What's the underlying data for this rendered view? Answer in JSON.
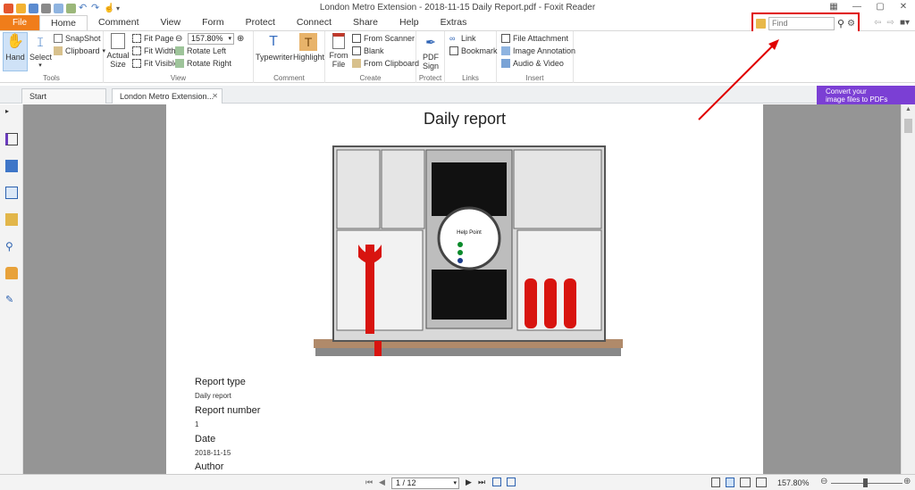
{
  "window": {
    "title": "London Metro Extension  -  2018-11-15 Daily Report.pdf - Foxit Reader"
  },
  "ribbon_tabs": [
    "File",
    "Home",
    "Comment",
    "View",
    "Form",
    "Protect",
    "Connect",
    "Share",
    "Help",
    "Extras"
  ],
  "active_tab": "Home",
  "find": {
    "placeholder": "Find"
  },
  "ribbon": {
    "tools": {
      "hand": "Hand",
      "select": "Select",
      "snapshot": "SnapShot",
      "clipboard": "Clipboard",
      "label": "Tools"
    },
    "view": {
      "actual_size": "Actual Size",
      "fit_page": "Fit Page",
      "fit_width": "Fit Width",
      "fit_visible": "Fit Visible",
      "zoom_value": "157.80%",
      "rotate_left": "Rotate Left",
      "rotate_right": "Rotate Right",
      "label": "View"
    },
    "comment": {
      "typewriter": "Typewriter",
      "highlight": "Highlight",
      "label": "Comment"
    },
    "create": {
      "from_file": "From File",
      "from_scanner": "From Scanner",
      "blank": "Blank",
      "from_clipboard": "From Clipboard",
      "label": "Create"
    },
    "protect": {
      "pdf_sign": "PDF Sign",
      "label": "Protect"
    },
    "links": {
      "link": "Link",
      "bookmark": "Bookmark",
      "label": "Links"
    },
    "insert": {
      "file_attachment": "File Attachment",
      "image_annotation": "Image Annotation",
      "audio_video": "Audio & Video",
      "label": "Insert"
    }
  },
  "doc_tabs": [
    "Start",
    "London Metro Extension..."
  ],
  "promo": {
    "line1": "Convert your",
    "line2": "image files to PDFs"
  },
  "document": {
    "heading": "Daily report",
    "fields": [
      {
        "label": "Report type",
        "value": "Daily report"
      },
      {
        "label": "Report number",
        "value": "1"
      },
      {
        "label": "Date",
        "value": "2018-11-15"
      },
      {
        "label": "Author",
        "value": ""
      }
    ],
    "machine_sign": {
      "title": "Help Point"
    }
  },
  "statusbar": {
    "page": "1 / 12",
    "zoom": "157.80%"
  },
  "colors": {
    "file_tab": "#f07d1a",
    "accent_red": "#e00000",
    "promo": "#7b3fd4",
    "workspace": "#959595"
  }
}
